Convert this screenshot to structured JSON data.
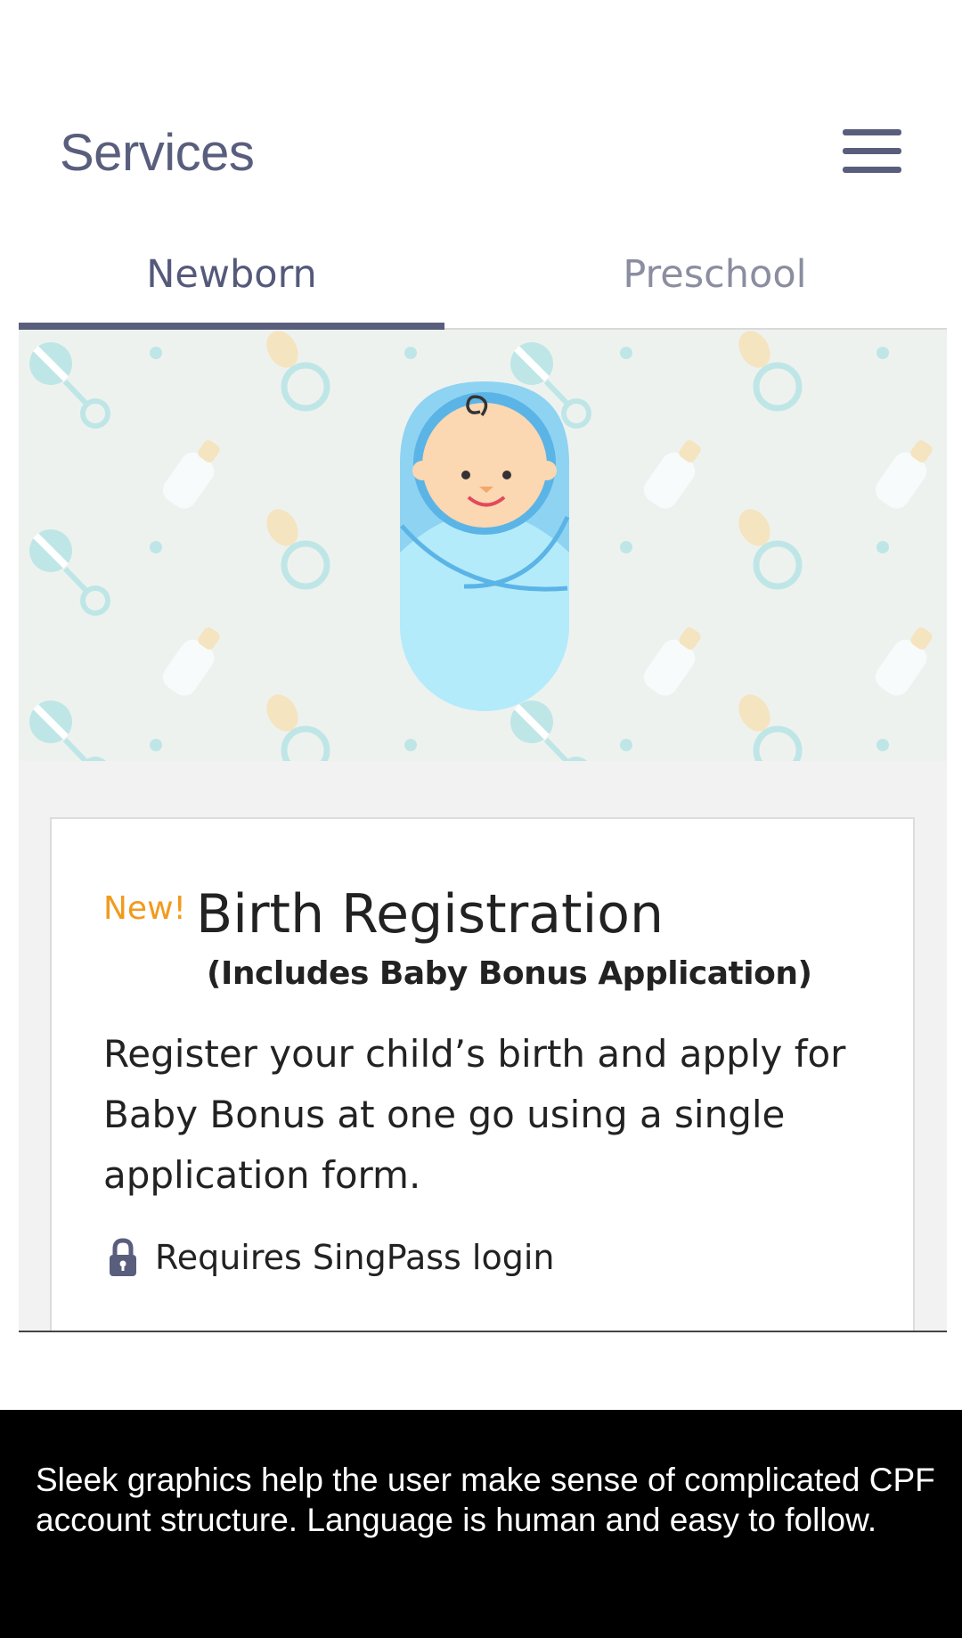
{
  "header": {
    "title": "Services",
    "menu_icon": "hamburger-menu-icon"
  },
  "tabs": [
    {
      "label": "Newborn",
      "active": true
    },
    {
      "label": "Preschool",
      "active": false
    }
  ],
  "banner": {
    "illustration": "swaddled-baby",
    "pattern_icons": [
      "rattle-icon",
      "pacifier-icon",
      "baby-bottle-icon"
    ]
  },
  "card": {
    "badge": "New!",
    "title": "Birth Registration",
    "subtitle": "(Includes Baby Bonus Application)",
    "description": "Register your child’s birth and apply for Baby Bonus at one go using a single application form.",
    "requirement": "Requires SingPass login",
    "requirement_icon": "lock-icon"
  },
  "caption": {
    "text": "Sleek graphics help the user make sense of complicated CPF account structure. Language is human and easy to follow."
  },
  "colors": {
    "primary": "#5a5e7d",
    "badge": "#f29a1d",
    "banner_bg": "#eef2ef",
    "baby_blue": "#b3ebfb"
  }
}
